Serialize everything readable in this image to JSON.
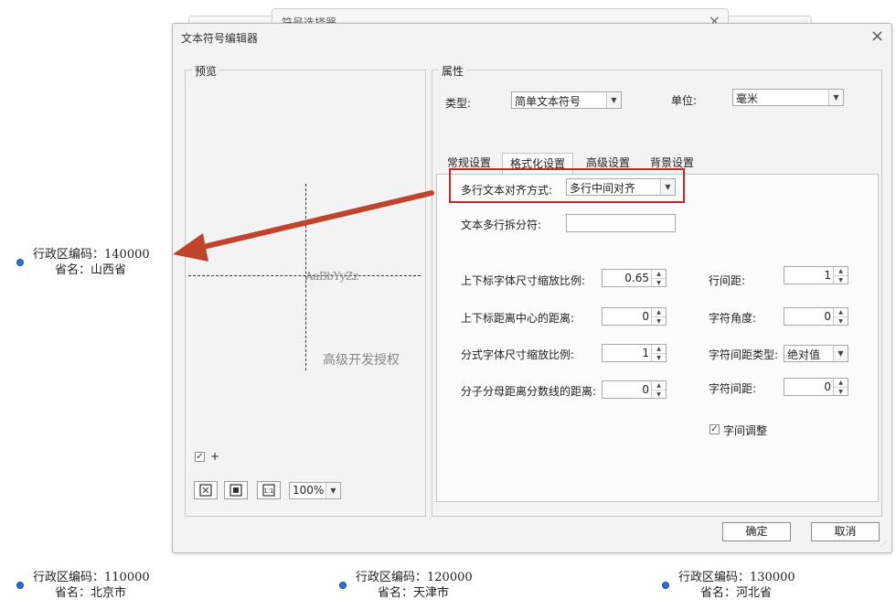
{
  "map": {
    "labels": [
      {
        "code_line": "行政区编码：140000",
        "name_line": "省名：山西省"
      },
      {
        "code_line": "行政区编码：110000",
        "name_line": "省名：北京市"
      },
      {
        "code_line": "行政区编码：120000",
        "name_line": "省名：天津市"
      },
      {
        "code_line": "行政区编码：130000",
        "name_line": "省名：河北省"
      }
    ]
  },
  "background_window": {
    "title": "符号选择器",
    "close": "×"
  },
  "dialog": {
    "title": "文本符号编辑器",
    "close": "×",
    "preview": {
      "group_title": "预览",
      "sample_text": "AaBbYyZz",
      "watermark": "高级开发授权",
      "plus_checkbox_label": "+",
      "plus_checked": true,
      "zoom_value": "100%",
      "buttons": [
        "zoom-extent-icon",
        "zoom-fit-icon",
        "actual-size-icon"
      ],
      "actual_size_glyph": "1:1"
    },
    "properties": {
      "group_title": "属性",
      "type_label": "类型:",
      "type_value": "简单文本符号",
      "unit_label": "单位:",
      "unit_value": "毫米",
      "tabs": [
        "常规设置",
        "格式化设置",
        "高级设置",
        "背景设置"
      ],
      "active_tab": "格式化设置",
      "highlight_color": "#c62828",
      "arrow_color": "#c0432b",
      "fields": {
        "multiline_align_label": "多行文本对齐方式:",
        "multiline_align_value": "多行中间对齐",
        "multiline_split_label": "文本多行拆分符:",
        "multiline_split_value": "",
        "script_scale_label": "上下标字体尺寸缩放比例:",
        "script_scale_value": "0.65",
        "script_offset_label": "上下标距离中心的距离:",
        "script_offset_value": "0",
        "fraction_scale_label": "分式字体尺寸缩放比例:",
        "fraction_scale_value": "1",
        "fraction_gap_label": "分子分母距离分数线的距离:",
        "fraction_gap_value": "0",
        "line_spacing_label": "行间距:",
        "line_spacing_value": "1",
        "char_angle_label": "字符角度:",
        "char_angle_value": "0",
        "char_spacing_type_label": "字符间距类型:",
        "char_spacing_type_value": "绝对值",
        "char_spacing_label": "字符间距:",
        "char_spacing_value": "0",
        "kerning_label": "字间调整",
        "kerning_checked": true
      }
    },
    "ok_label": "确定",
    "cancel_label": "取消"
  }
}
